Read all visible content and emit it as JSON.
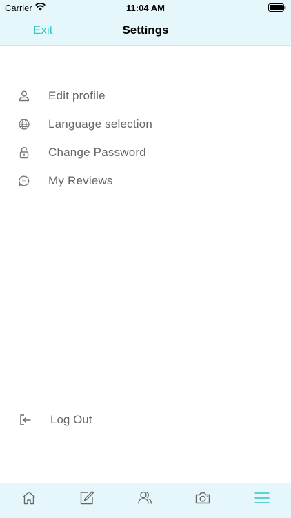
{
  "status_bar": {
    "carrier": "Carrier",
    "time": "11:04 AM"
  },
  "nav": {
    "back_label": "Exit",
    "title": "Settings"
  },
  "menu": {
    "items": [
      {
        "label": "Edit profile",
        "icon": "user-icon"
      },
      {
        "label": "Language selection",
        "icon": "globe-icon"
      },
      {
        "label": "Change Password",
        "icon": "lock-icon"
      },
      {
        "label": "My Reviews",
        "icon": "chat-bubble-icon"
      }
    ]
  },
  "logout": {
    "label": "Log Out",
    "icon": "logout-icon"
  },
  "tab_bar": {
    "tabs": [
      {
        "icon": "home-icon"
      },
      {
        "icon": "edit-icon"
      },
      {
        "icon": "users-icon"
      },
      {
        "icon": "camera-icon"
      },
      {
        "icon": "menu-icon",
        "active": true
      }
    ]
  },
  "colors": {
    "accent": "#2fc6c6",
    "bar_background": "#e6f7fb",
    "label_text": "#666666",
    "icon_gray": "#777777"
  }
}
